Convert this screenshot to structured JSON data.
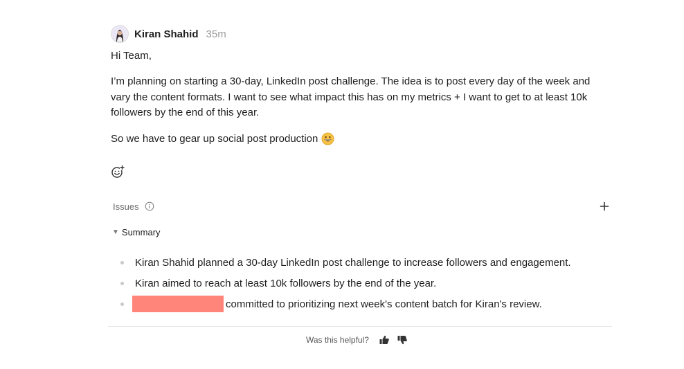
{
  "post": {
    "author": "Kiran Shahid",
    "time": "35m",
    "greeting": "Hi Team,",
    "paragraph1": "I’m planning on starting a 30-day, LinkedIn post challenge. The idea is to post every day of the week and vary the content formats. I want to see what impact this has on my metrics + I want to get to at least 10k followers by the end of this year.",
    "paragraph2": "So we have to gear up social post production",
    "emoji": "grinning-face-emoji",
    "reaction_icon": "add-reaction-icon"
  },
  "issues": {
    "label": "Issues",
    "info_icon": "info-icon",
    "add_icon": "plus-icon"
  },
  "summary": {
    "label": "Summary",
    "items": [
      "Kiran Shahid planned a 30-day LinkedIn post challenge to increase followers and engagement.",
      "Kiran aimed to reach at least 10k followers by the end of the year.",
      "committed to prioritizing next week's content batch for Kiran's review."
    ],
    "redaction_color": "#ff857b"
  },
  "feedback": {
    "label": "Was this helpful?",
    "thumbs_up_icon": "thumbs-up-icon",
    "thumbs_down_icon": "thumbs-down-icon"
  }
}
